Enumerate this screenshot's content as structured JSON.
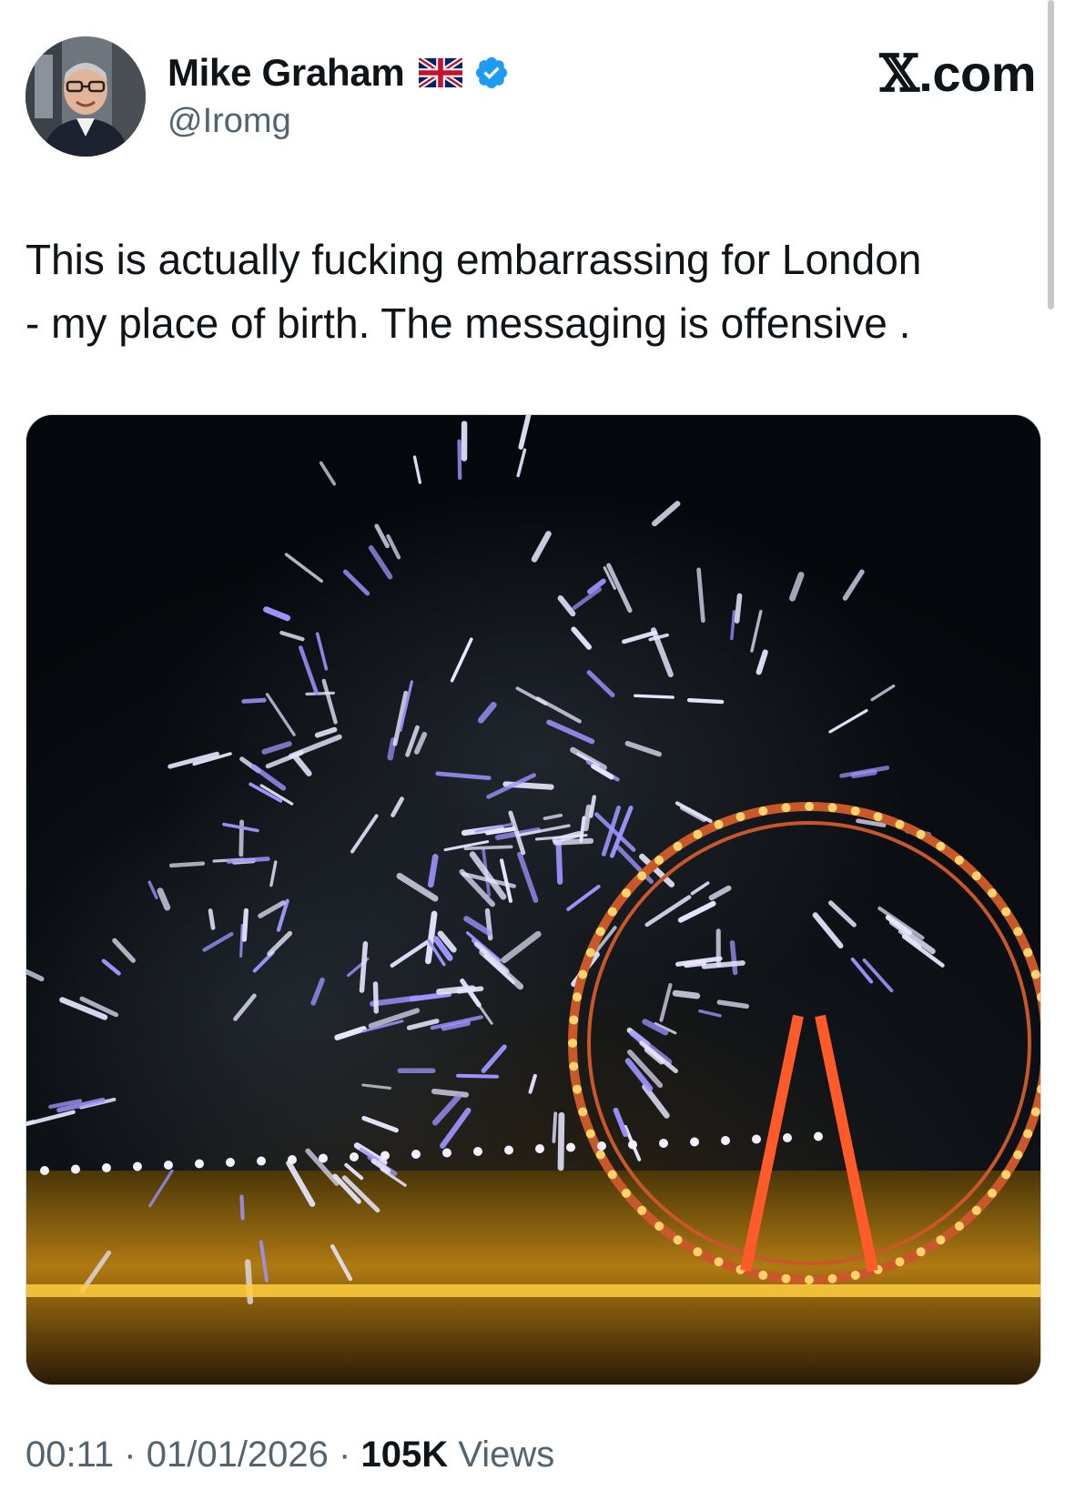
{
  "author": {
    "display_name": "Mike Graham",
    "handle": "@Iromg",
    "flag_icon": "uk-flag-icon",
    "verified_icon": "verified-badge-icon",
    "verified_color": "#1d9bf0"
  },
  "site_label": "X.com",
  "tweet": {
    "text": "This is actually fucking embarrassing for London\n- my place of birth. The messaging is offensive ."
  },
  "media": {
    "icon": "photo-fireworks-london-eye"
  },
  "meta": {
    "time": "00:11",
    "separator": "·",
    "date": "01/01/2026",
    "views_count": "105K",
    "views_label": "Views"
  }
}
